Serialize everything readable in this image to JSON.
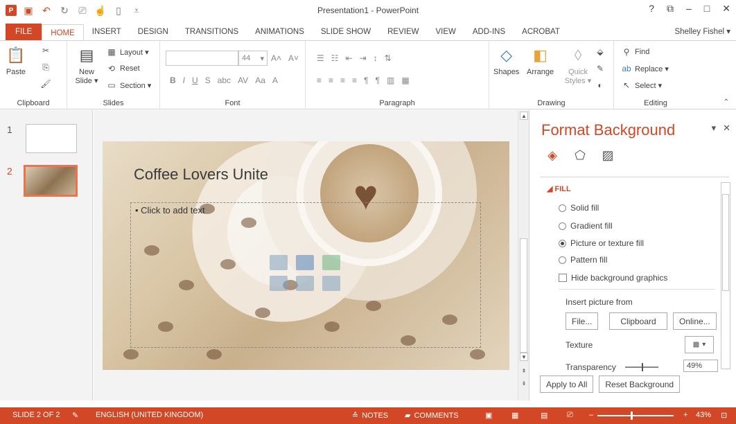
{
  "window": {
    "title": "Presentation1 - PowerPoint",
    "controls": [
      "?",
      "⧉",
      "–",
      "□",
      "✕"
    ]
  },
  "tabs": [
    "FILE",
    "HOME",
    "INSERT",
    "DESIGN",
    "TRANSITIONS",
    "ANIMATIONS",
    "SLIDE SHOW",
    "REVIEW",
    "VIEW",
    "ADD-INS",
    "ACROBAT"
  ],
  "user": "Shelley Fishel ▾",
  "ribbon": {
    "clipboard": {
      "label": "Clipboard",
      "paste": "Paste"
    },
    "slides": {
      "label": "Slides",
      "new_slide": "New Slide ▾",
      "layout": "Layout ▾",
      "reset": "Reset",
      "section": "Section ▾"
    },
    "font": {
      "label": "Font",
      "size": "44"
    },
    "paragraph": {
      "label": "Paragraph"
    },
    "drawing": {
      "label": "Drawing",
      "shapes": "Shapes",
      "arrange": "Arrange",
      "quick_styles": "Quick Styles ▾"
    },
    "editing": {
      "label": "Editing",
      "find": "Find",
      "replace": "Replace ▾",
      "select": "Select ▾"
    }
  },
  "thumbnails": [
    {
      "number": "1"
    },
    {
      "number": "2"
    }
  ],
  "slide": {
    "title": "Coffee Lovers Unite",
    "content_placeholder": "• Click to add text"
  },
  "pane": {
    "title": "Format Background",
    "section": "◢ FILL",
    "options": [
      "Solid fill",
      "Gradient fill",
      "Picture or texture fill",
      "Pattern fill"
    ],
    "selected_option": "Picture or texture fill",
    "hide_graphics": "Hide background graphics",
    "insert_from": "Insert picture from",
    "file_btn": "File...",
    "clipboard_btn": "Clipboard",
    "online_btn": "Online...",
    "texture": "Texture",
    "transparency": "Transparency",
    "transparency_value": "49%",
    "transparency_fraction": 0.49,
    "apply_all": "Apply to All",
    "reset_bg": "Reset Background"
  },
  "status": {
    "slide": "SLIDE 2 OF 2",
    "language": "ENGLISH (UNITED KINGDOM)",
    "notes": "NOTES",
    "comments": "COMMENTS",
    "zoom": "43%"
  }
}
